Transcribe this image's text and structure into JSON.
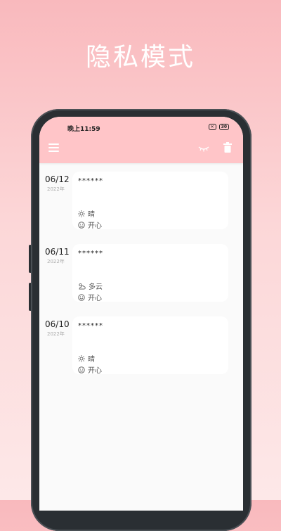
{
  "headline": "隐私模式",
  "status": {
    "time": "晚上11:59",
    "battery": "30"
  },
  "toolbar": {
    "menu_icon": "menu-icon",
    "eye_icon": "eye-closed-icon",
    "trash_icon": "trash-icon"
  },
  "entries": [
    {
      "date": "06/12",
      "year": "2022年",
      "title": "******",
      "weather": "晴",
      "weather_icon": "sun-icon",
      "mood": "开心",
      "mood_icon": "smile-icon"
    },
    {
      "date": "06/11",
      "year": "2022年",
      "title": "******",
      "weather": "多云",
      "weather_icon": "cloud-icon",
      "mood": "开心",
      "mood_icon": "smile-icon"
    },
    {
      "date": "06/10",
      "year": "2022年",
      "title": "******",
      "weather": "晴",
      "weather_icon": "sun-icon",
      "mood": "开心",
      "mood_icon": "smile-icon"
    }
  ],
  "colors": {
    "appbar": "#ffc5c8",
    "background_top": "#f9b9bd",
    "background_bottom": "#fde8e8"
  }
}
